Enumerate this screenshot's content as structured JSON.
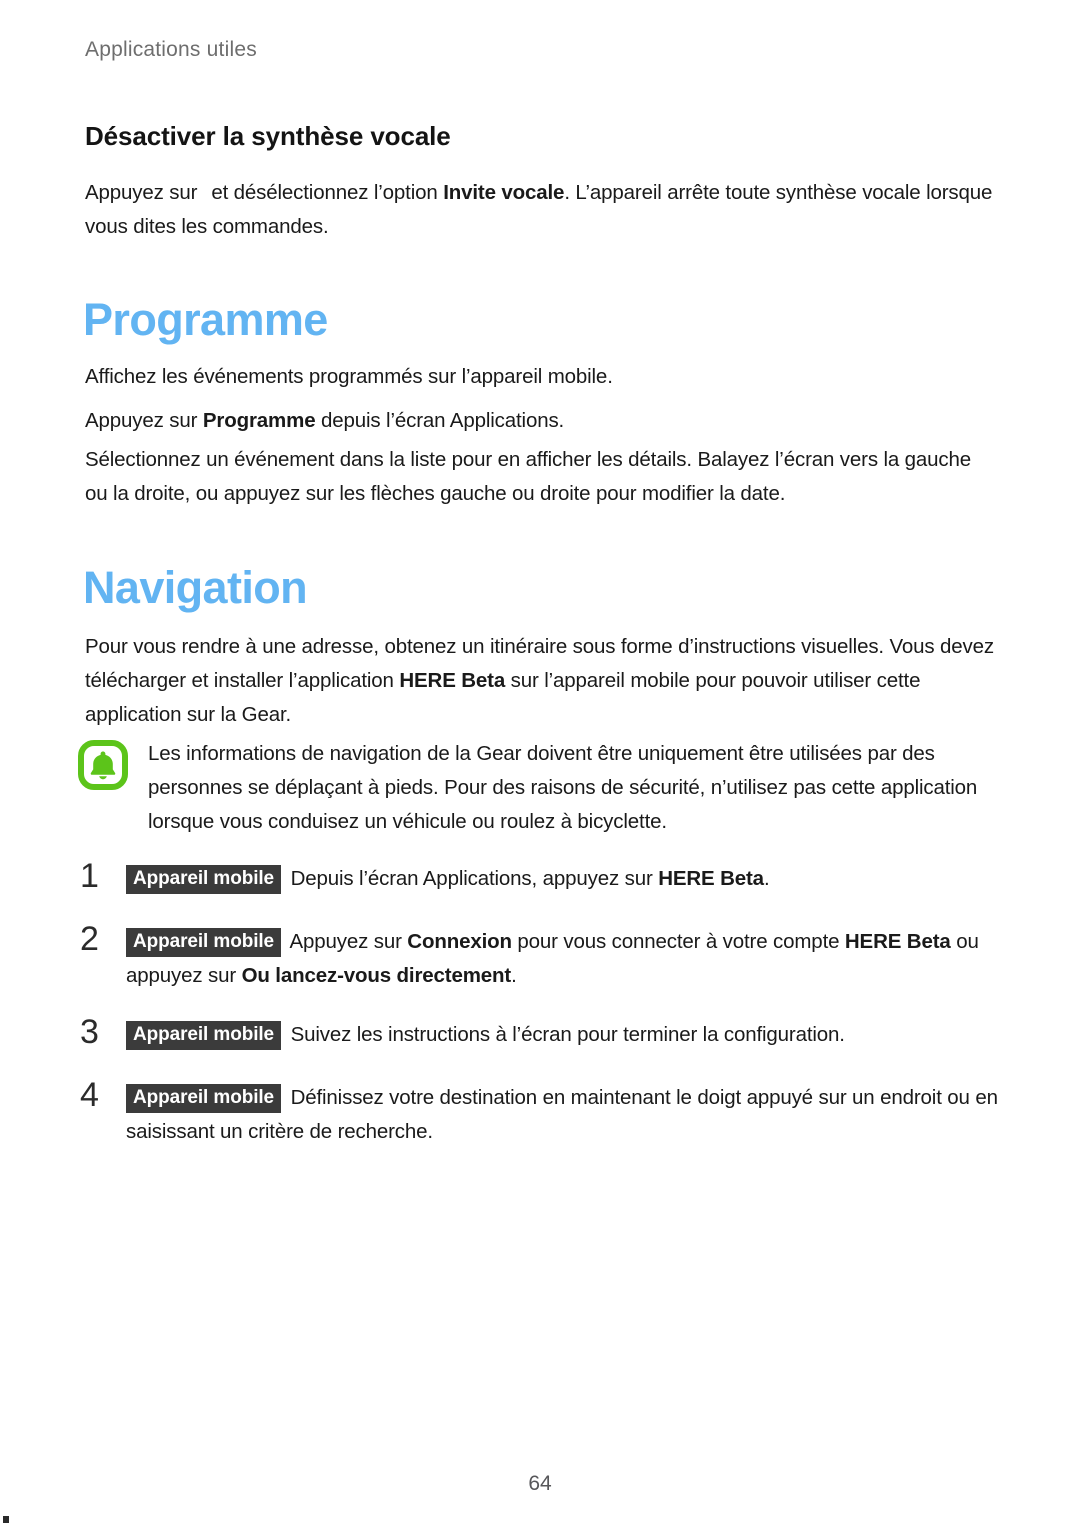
{
  "document": {
    "running_header": "Applications utiles",
    "page_number": "64",
    "accent_heading_color": "#62b4f2",
    "badge_color": "#3b3b3b",
    "note_icon_color": "#5cc41a"
  },
  "sections": {
    "disable_tts": {
      "heading": "Désactiver la synthèse vocale",
      "paragraph_before_icon": "Appuyez sur",
      "paragraph_after_icon_1": "et désélectionnez l’option ",
      "paragraph_bold_1": "Invite vocale",
      "paragraph_after_icon_2": ". L’appareil arrête toute synthèse vocale lorsque vous dites les commandes."
    },
    "programme": {
      "heading": "Programme",
      "paragraph_1": "Affichez les événements programmés sur l’appareil mobile.",
      "paragraph_2_part_1": "Appuyez sur ",
      "paragraph_2_bold": "Programme",
      "paragraph_2_part_2": " depuis l’écran Applications.",
      "paragraph_3": "Sélectionnez un événement dans la liste pour en afficher les détails. Balayez l’écran vers la gauche ou la droite, ou appuyez sur les flèches gauche ou droite pour modifier la date."
    },
    "navigation": {
      "heading": "Navigation",
      "paragraph_1_part_1": "Pour vous rendre à une adresse, obtenez un itinéraire sous forme d’instructions visuelles. Vous devez télécharger et installer l’application ",
      "paragraph_1_bold": "HERE Beta",
      "paragraph_1_part_2": " sur l’appareil mobile pour pouvoir utiliser cette application sur la Gear.",
      "note": {
        "icon_name": "bell-notice-icon",
        "text": "Les informations de navigation de la Gear doivent être uniquement être utilisées par des personnes se déplaçant à pieds. Pour des raisons de sécurité, n’utilisez pas cette application lorsque vous conduisez un véhicule ou roulez à bicyclette."
      },
      "steps": [
        {
          "number": "1",
          "badge": "Appareil mobile",
          "parts": [
            {
              "text": " Depuis l’écran Applications, appuyez sur ",
              "bold": false
            },
            {
              "text": "HERE Beta",
              "bold": true
            },
            {
              "text": ".",
              "bold": false
            }
          ]
        },
        {
          "number": "2",
          "badge": "Appareil mobile",
          "parts": [
            {
              "text": " Appuyez sur ",
              "bold": false
            },
            {
              "text": "Connexion",
              "bold": true
            },
            {
              "text": " pour vous connecter à votre compte ",
              "bold": false
            },
            {
              "text": "HERE Beta",
              "bold": true
            },
            {
              "text": " ou appuyez sur ",
              "bold": false
            },
            {
              "text": "Ou lancez-vous directement",
              "bold": true
            },
            {
              "text": ".",
              "bold": false
            }
          ]
        },
        {
          "number": "3",
          "badge": "Appareil mobile",
          "parts": [
            {
              "text": " Suivez les instructions à l’écran pour terminer la configuration.",
              "bold": false
            }
          ]
        },
        {
          "number": "4",
          "badge": "Appareil mobile",
          "parts": [
            {
              "text": " Définissez votre destination en maintenant le doigt appuyé sur un endroit ou en saisissant un critère de recherche.",
              "bold": false
            }
          ]
        }
      ]
    }
  }
}
